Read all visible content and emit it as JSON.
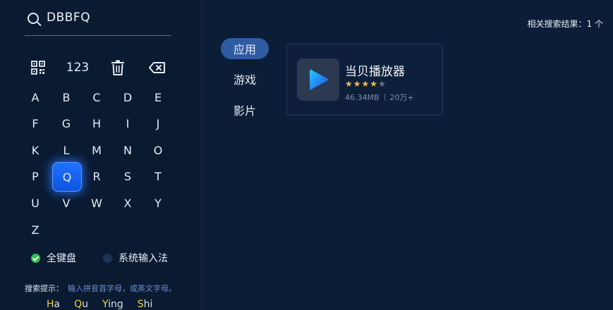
{
  "search": {
    "query": "DBBFQ"
  },
  "function_keys": [
    {
      "name": "qr-code-key",
      "label": ""
    },
    {
      "name": "numeric-key",
      "label": "123"
    },
    {
      "name": "clear-key",
      "label": ""
    },
    {
      "name": "backspace-key",
      "label": ""
    }
  ],
  "keyboard": {
    "keys": [
      "A",
      "B",
      "C",
      "D",
      "E",
      "F",
      "G",
      "H",
      "I",
      "J",
      "K",
      "L",
      "M",
      "N",
      "O",
      "P",
      "Q",
      "R",
      "S",
      "T",
      "U",
      "V",
      "W",
      "X",
      "Y",
      "Z"
    ],
    "selected": "Q"
  },
  "input_methods": [
    {
      "label": "全键盘",
      "selected": true
    },
    {
      "label": "系统输入法",
      "selected": false
    }
  ],
  "hint": {
    "label": "搜索提示：",
    "text": "输入拼音首字母，或英文字母。",
    "examples": [
      {
        "cap": "H",
        "rest": "a"
      },
      {
        "cap": "Q",
        "rest": "u"
      },
      {
        "cap": "Y",
        "rest": "ing"
      },
      {
        "cap": "S",
        "rest": "hi"
      }
    ]
  },
  "results": {
    "count_text": "相关搜索结果：1 个"
  },
  "categories": [
    {
      "label": "应用",
      "active": true
    },
    {
      "label": "游戏",
      "active": false
    },
    {
      "label": "影片",
      "active": false
    }
  ],
  "apps": [
    {
      "name": "当贝播放器",
      "rating": 4,
      "rating_max": 5,
      "size": "46.34MB",
      "downloads": "20万+",
      "icon": "play-icon",
      "icon_colors": [
        "#2cc6ff",
        "#1a56e8"
      ]
    }
  ]
}
